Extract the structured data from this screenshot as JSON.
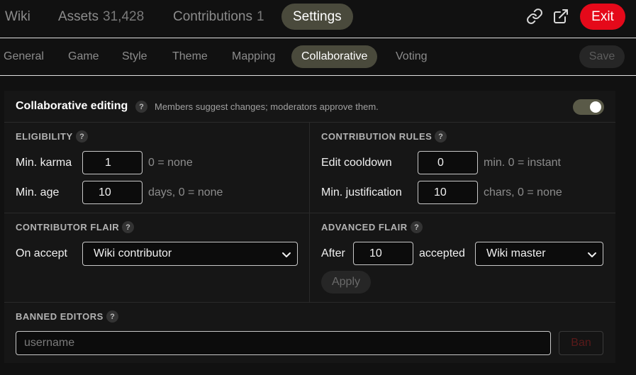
{
  "topbar": {
    "tabs": [
      {
        "label": "Wiki",
        "count": ""
      },
      {
        "label": "Assets",
        "count": "31,428"
      },
      {
        "label": "Contributions",
        "count": "1"
      },
      {
        "label": "Settings",
        "count": ""
      }
    ],
    "active_tab": "Settings",
    "icons": [
      "link-icon",
      "external-link-icon"
    ],
    "exit_label": "Exit"
  },
  "subtabs": {
    "items": [
      "General",
      "Game",
      "Style",
      "Theme",
      "Mapping",
      "Collaborative",
      "Voting"
    ],
    "active": "Collaborative",
    "save_label": "Save"
  },
  "collab": {
    "title": "Collaborative editing",
    "help": "?",
    "description": "Members suggest changes; moderators approve them.",
    "enabled": true
  },
  "eligibility": {
    "heading": "ELIGIBILITY",
    "help": "?",
    "karma_label": "Min. karma",
    "karma_value": "1",
    "karma_hint": "0 = none",
    "age_label": "Min. age",
    "age_value": "10",
    "age_hint": "days, 0 = none"
  },
  "rules": {
    "heading": "CONTRIBUTION RULES",
    "help": "?",
    "cooldown_label": "Edit cooldown",
    "cooldown_value": "0",
    "cooldown_hint": "min. 0 = instant",
    "justification_label": "Min. justification",
    "justification_value": "10",
    "justification_hint": "chars, 0 = none"
  },
  "flair": {
    "heading": "CONTRIBUTOR FLAIR",
    "help": "?",
    "on_accept_label": "On accept",
    "on_accept_value": "Wiki contributor"
  },
  "advanced": {
    "heading": "ADVANCED FLAIR",
    "help": "?",
    "after_label": "After",
    "after_value": "10",
    "accepted_label": "accepted",
    "flair_value": "Wiki master",
    "apply_label": "Apply"
  },
  "banned": {
    "heading": "BANNED EDITORS",
    "help": "?",
    "placeholder": "username",
    "ban_label": "Ban"
  },
  "colors": {
    "accent": "#4a4a3c",
    "exit": "#e5091a",
    "background": "#111111"
  }
}
